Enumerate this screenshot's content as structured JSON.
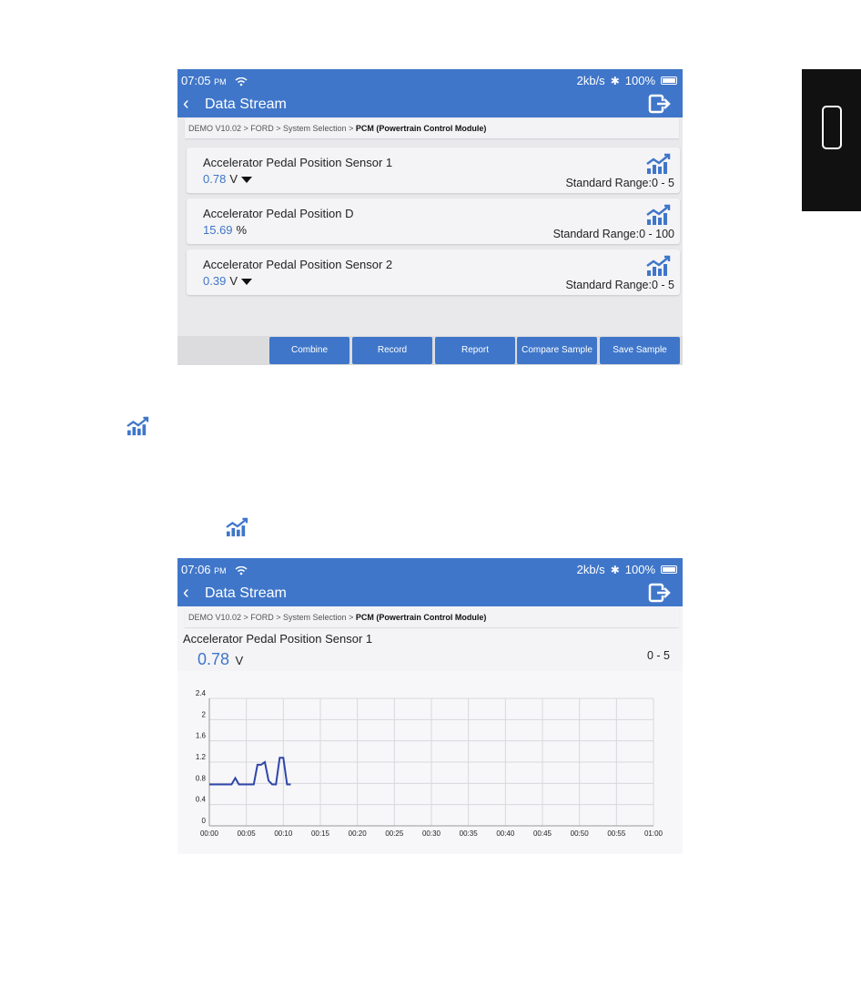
{
  "colors": {
    "accent": "#3f76c9",
    "line": "#2f46a8"
  },
  "screen1": {
    "status": {
      "time": "07:05",
      "ampm": "PM",
      "speed": "2kb/s",
      "battery": "100%"
    },
    "title": "Data Stream",
    "breadcrumb": {
      "path": "DEMO V10.02 > FORD > System Selection > ",
      "current": "PCM (Powertrain Control Module)"
    },
    "rows": [
      {
        "name": "Accelerator Pedal Position Sensor 1",
        "value": "0.78",
        "unit": "V",
        "range": "Standard Range:0 - 5",
        "arrow": true
      },
      {
        "name": "Accelerator Pedal Position D",
        "value": "15.69",
        "unit": "%",
        "range": "Standard Range:0 - 100",
        "arrow": false
      },
      {
        "name": "Accelerator Pedal Position Sensor 2",
        "value": "0.39",
        "unit": "V",
        "range": "Standard Range:0 - 5",
        "arrow": true
      }
    ],
    "buttons": [
      "Combine",
      "Record",
      "Report",
      "Compare Sample",
      "Save Sample"
    ]
  },
  "screen2": {
    "status": {
      "time": "07:06",
      "ampm": "PM",
      "speed": "2kb/s",
      "battery": "100%"
    },
    "title": "Data Stream",
    "breadcrumb": {
      "path": "DEMO V10.02 > FORD > System Selection > ",
      "current": "PCM (Powertrain Control Module)"
    },
    "sensor": {
      "name": "Accelerator Pedal Position Sensor 1",
      "value": "0.78",
      "unit": "V",
      "range": "0 - 5"
    }
  },
  "chart_data": {
    "type": "line",
    "x_ticks": [
      "00:00",
      "00:05",
      "00:10",
      "00:15",
      "00:20",
      "00:25",
      "00:30",
      "00:35",
      "00:40",
      "00:45",
      "00:50",
      "00:55",
      "01:00"
    ],
    "y_ticks": [
      "0",
      "0.4",
      "0.8",
      "1.2",
      "1.6",
      "2",
      "2.4"
    ],
    "xlim": [
      0,
      60
    ],
    "ylim": [
      0,
      2.4
    ],
    "grid": true,
    "series": [
      {
        "x": [
          0,
          1,
          2,
          3,
          3.5,
          4,
          4.5,
          5,
          6,
          6.5,
          7,
          7.5,
          8,
          8.5,
          9,
          9.5,
          10,
          10.5,
          11
        ],
        "y": [
          0.78,
          0.78,
          0.78,
          0.78,
          0.9,
          0.78,
          0.78,
          0.78,
          0.78,
          1.15,
          1.15,
          1.2,
          0.85,
          0.78,
          0.78,
          1.28,
          1.28,
          0.78,
          0.78
        ]
      }
    ]
  }
}
